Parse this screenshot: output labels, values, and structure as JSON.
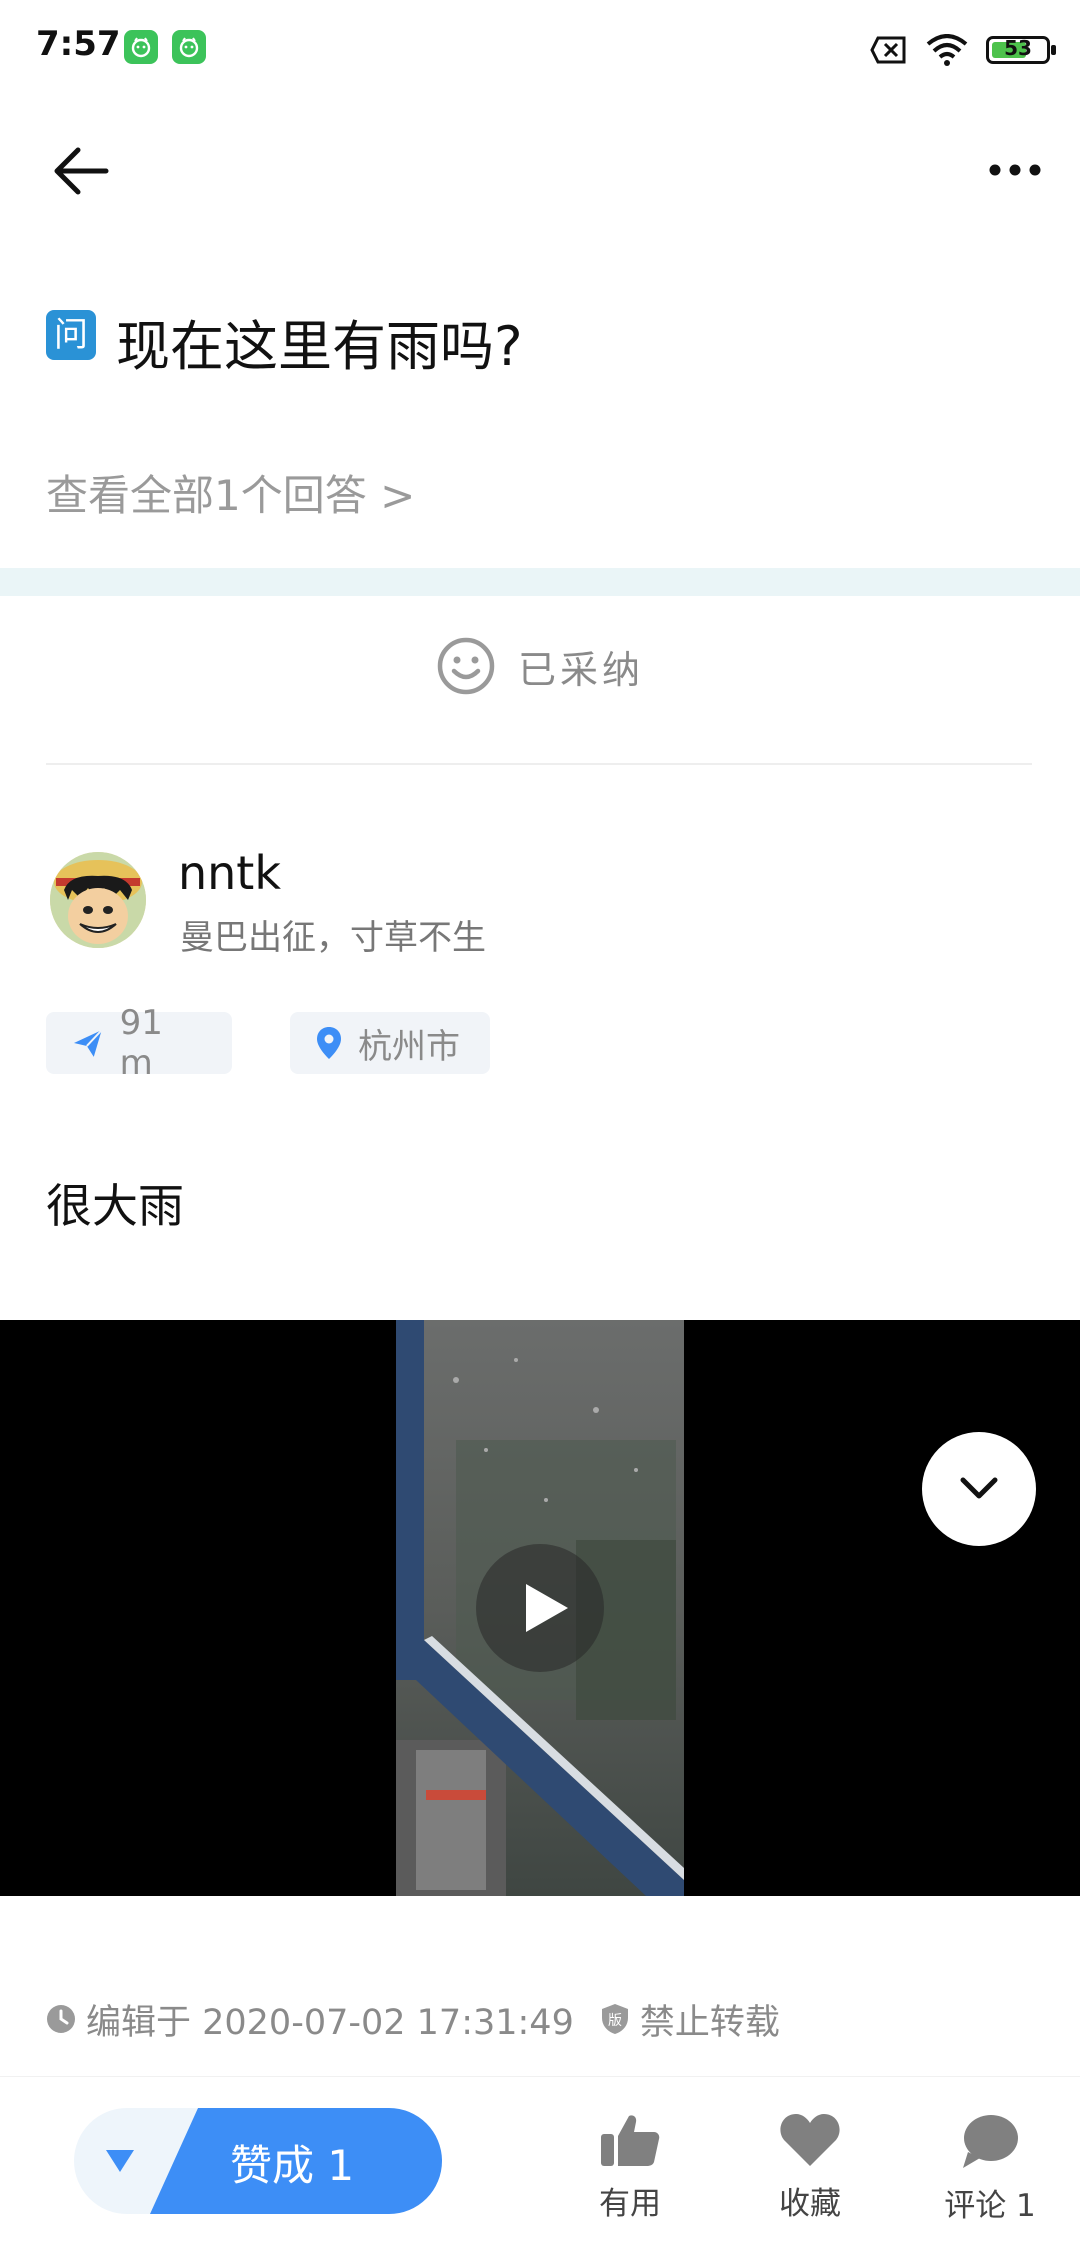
{
  "status_bar": {
    "time": "7:57",
    "battery": "53",
    "icons": [
      "app-badge-icon",
      "app-badge-icon",
      "sim-x-icon",
      "wifi-icon",
      "battery-icon"
    ]
  },
  "question": {
    "badge": "问",
    "title": "现在这里有雨吗?",
    "view_all": "查看全部1个回答 >"
  },
  "answer": {
    "accepted_label": "已采纳",
    "username": "nntk",
    "bio": "曼巴出征，寸草不生",
    "distance": "91 m",
    "city": "杭州市",
    "text": "很大雨",
    "edited_label": "编辑于 2020-07-02 17:31:49",
    "copyright_badge": "版",
    "copyright_label": "禁止转载"
  },
  "bottom_bar": {
    "upvote_label": "赞成 1",
    "useful_label": "有用",
    "favorite_label": "收藏",
    "comment_label": "评论 1"
  },
  "colors": {
    "accent": "#3d8ef6",
    "badge_blue": "#2a92d6",
    "band": "#eaf5f7",
    "app_green": "#3cc35a"
  }
}
